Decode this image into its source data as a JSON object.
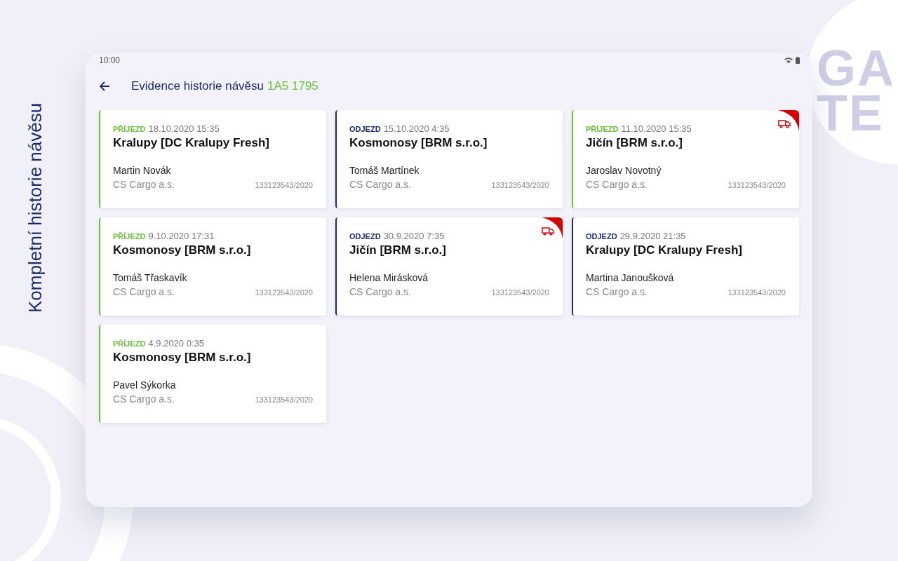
{
  "side_heading": "Kompletní historie návěsu",
  "background_logo": [
    "GA",
    "TE"
  ],
  "status_bar": {
    "time": "10:00"
  },
  "header": {
    "title": "Evidence historie návěsu",
    "trailer": "1A5 1795"
  },
  "records": [
    {
      "kind": "arrival",
      "label": "PŘÍJEZD",
      "datetime": "18.10.2020 15:35",
      "place": "Kralupy [DC Kralupy Fresh]",
      "driver": "Martin Novák",
      "company": "CS Cargo a.s.",
      "number": "133123543/2020",
      "flagged": false
    },
    {
      "kind": "departure",
      "label": "ODJEZD",
      "datetime": "15.10.2020 4:35",
      "place": "Kosmonosy [BRM s.r.o.]",
      "driver": "Tomáš Martínek",
      "company": "CS Cargo a.s.",
      "number": "133123543/2020",
      "flagged": false
    },
    {
      "kind": "arrival",
      "label": "PŘÍJEZD",
      "datetime": "11.10.2020 15:35",
      "place": "Jičín [BRM s.r.o.]",
      "driver": "Jaroslav Novotný",
      "company": "CS Cargo a.s.",
      "number": "133123543/2020",
      "flagged": true
    },
    {
      "kind": "arrival",
      "label": "PŘÍJEZD",
      "datetime": "9.10.2020 17:31",
      "place": "Kosmonosy [BRM s.r.o.]",
      "driver": "Tomáš Třaskavík",
      "company": "CS Cargo a.s.",
      "number": "133123543/2020",
      "flagged": false
    },
    {
      "kind": "departure",
      "label": "ODJEZD",
      "datetime": "30.9.2020 7:35",
      "place": "Jičín [BRM s.r.o.]",
      "driver": "Helena Mirásková",
      "company": "CS Cargo a.s.",
      "number": "133123543/2020",
      "flagged": true
    },
    {
      "kind": "departure",
      "label": "ODJEZD",
      "datetime": "29.9.2020 21:35",
      "place": "Kralupy [DC Kralupy Fresh]",
      "driver": "Martina Janoušková",
      "company": "CS Cargo a.s.",
      "number": "133123543/2020",
      "flagged": false
    },
    {
      "kind": "arrival",
      "label": "PŘÍJEZD",
      "datetime": "4.9.2020 0:35",
      "place": "Kosmonosy [BRM s.r.o.]",
      "driver": "Pavel  Sýkorka",
      "company": "CS Cargo a.s.",
      "number": "133123543/2020",
      "flagged": false
    }
  ]
}
